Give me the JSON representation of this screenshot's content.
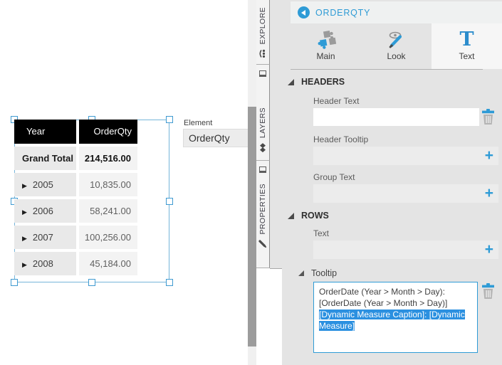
{
  "canvas": {
    "element_label": "Element",
    "element_value": "OrderQty",
    "table": {
      "columns": [
        "Year",
        "OrderQty"
      ],
      "expander_glyph": "▶",
      "grand_total": {
        "label": "Grand Total",
        "value": "214,516.00"
      },
      "rows": [
        {
          "year": "2005",
          "value": "10,835.00"
        },
        {
          "year": "2006",
          "value": "58,241.00"
        },
        {
          "year": "2007",
          "value": "100,256.00"
        },
        {
          "year": "2008",
          "value": "45,184.00"
        }
      ]
    }
  },
  "side_tabs": [
    {
      "label": "EXPLORE",
      "icon": "explore-icon"
    },
    {
      "label": "LAYERS",
      "icon": "layers-icon"
    },
    {
      "label": "PROPERTIES",
      "icon": "pencil-icon"
    }
  ],
  "panel": {
    "title": "ORDERQTY",
    "back_icon": "back-arrow-icon",
    "tabs": [
      {
        "label": "Main",
        "icon": "puzzle-icon",
        "active": false
      },
      {
        "label": "Look",
        "icon": "eye-brush-icon",
        "active": false
      },
      {
        "label": "Text",
        "icon": "letter-t-icon",
        "icon_glyph": "T",
        "active": true
      }
    ],
    "headers_section": {
      "title": "HEADERS",
      "header_text_label": "Header Text",
      "header_text_value": "",
      "header_tooltip_label": "Header Tooltip",
      "group_text_label": "Group Text"
    },
    "rows_section": {
      "title": "ROWS",
      "text_label": "Text",
      "tooltip_label": "Tooltip",
      "tooltip_lines": [
        {
          "text": "OrderDate (Year > Month > Day):",
          "selected": false
        },
        {
          "text": "[OrderDate (Year > Month > Day)]",
          "selected": false
        },
        {
          "text": "[Dynamic Measure Caption]: [Dynamic",
          "selected": true
        },
        {
          "text": "Measure]",
          "selected": true
        }
      ]
    }
  },
  "icons": {
    "plus": "+",
    "delete": "trash-icon"
  },
  "colors": {
    "accent_blue": "#2e9bd6",
    "selection_blue": "#2b90e0",
    "table_header_bg": "#000000",
    "panel_bg": "#e4e4e4"
  }
}
